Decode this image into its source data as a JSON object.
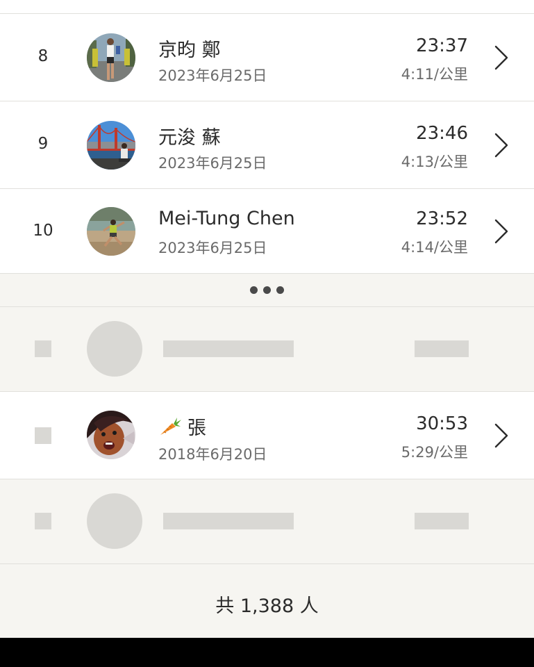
{
  "leaderboard": {
    "entries": [
      {
        "rank": "8",
        "name": "京昀 鄭",
        "date": "2023年6月25日",
        "time": "23:37",
        "pace": "4:11/公里",
        "avatar": "runner-photo-avatar"
      },
      {
        "rank": "9",
        "name": "元浚 蘇",
        "date": "2023年6月25日",
        "time": "23:46",
        "pace": "4:13/公里",
        "avatar": "golden-gate-bridge-photo-avatar"
      },
      {
        "rank": "10",
        "name": "Mei-Tung Chen",
        "date": "2023年6月25日",
        "time": "23:52",
        "pace": "4:14/公里",
        "avatar": "trail-runner-photo-avatar"
      }
    ],
    "more_indicator": "•••",
    "current_user": {
      "name_emoji": "carrot-emoji",
      "name": "張",
      "date": "2018年6月20日",
      "time": "30:53",
      "pace": "5:29/公里",
      "avatar": "face-photo-avatar"
    },
    "total": "共 1,388 人"
  },
  "colors": {
    "background": "#f6f5f1",
    "card": "#ffffff",
    "placeholder": "#d9d8d4",
    "text_primary": "#2b2b2b",
    "text_secondary": "#6a6a6a",
    "divider": "#e1e0dc"
  }
}
